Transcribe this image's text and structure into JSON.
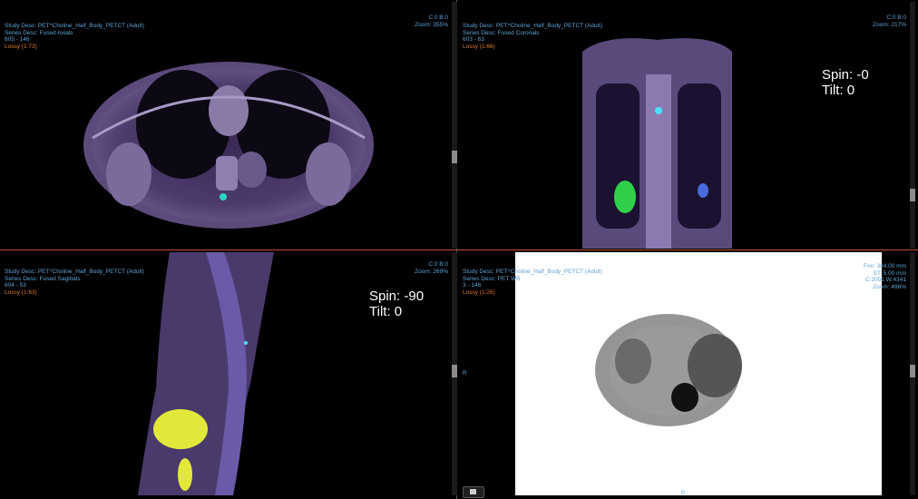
{
  "viewports": {
    "tl": {
      "study": "Study Desc: PET^Choline_Half_Body_PETCT (Adult)",
      "series": "Series Desc: Fused Axials",
      "pos": "605 - 146",
      "lossy": "Lossy (1:73)",
      "wl": "C:0 B:0",
      "zoom": "Zoom: 355%"
    },
    "tr": {
      "study": "Study Desc: PET^Choline_Half_Body_PETCT (Adult)",
      "series": "Series Desc: Fused Coronals",
      "pos": "603 - 63",
      "lossy": "Lossy (1:66)",
      "wl": "C:0 B:0",
      "zoom": "Zoom: 217%",
      "spin": "Spin: -0",
      "tilt": "Tilt: 0"
    },
    "bl": {
      "study": "Study Desc: PET^Choline_Half_Body_PETCT (Adult)",
      "series": "Series Desc: Fused Sagittals",
      "pos": "604 - 53",
      "lossy": "Lossy (1:63)",
      "wl": "C:0 B:0",
      "zoom": "Zoom: 269%",
      "spin": "Spin: -90",
      "tilt": "Tilt: 0"
    },
    "br": {
      "study": "Study Desc: PET^Choline_Half_Body_PETCT (Adult)",
      "series": "Series Desc: PET WB",
      "pos": "3 - 146",
      "lossy": "Lossy (1:26)",
      "fov": "Fov: 384.00 mm",
      "st": "ST: 5.00 mm",
      "wl": "C:2001 W:4341",
      "zoom": "Zoom: 496%",
      "orient_left": "R",
      "orient_bottom": "P"
    }
  },
  "colors": {
    "overlay_text": "#5ea2d6",
    "lossy_text": "#e07a2d",
    "active_border": "#c6522b"
  }
}
